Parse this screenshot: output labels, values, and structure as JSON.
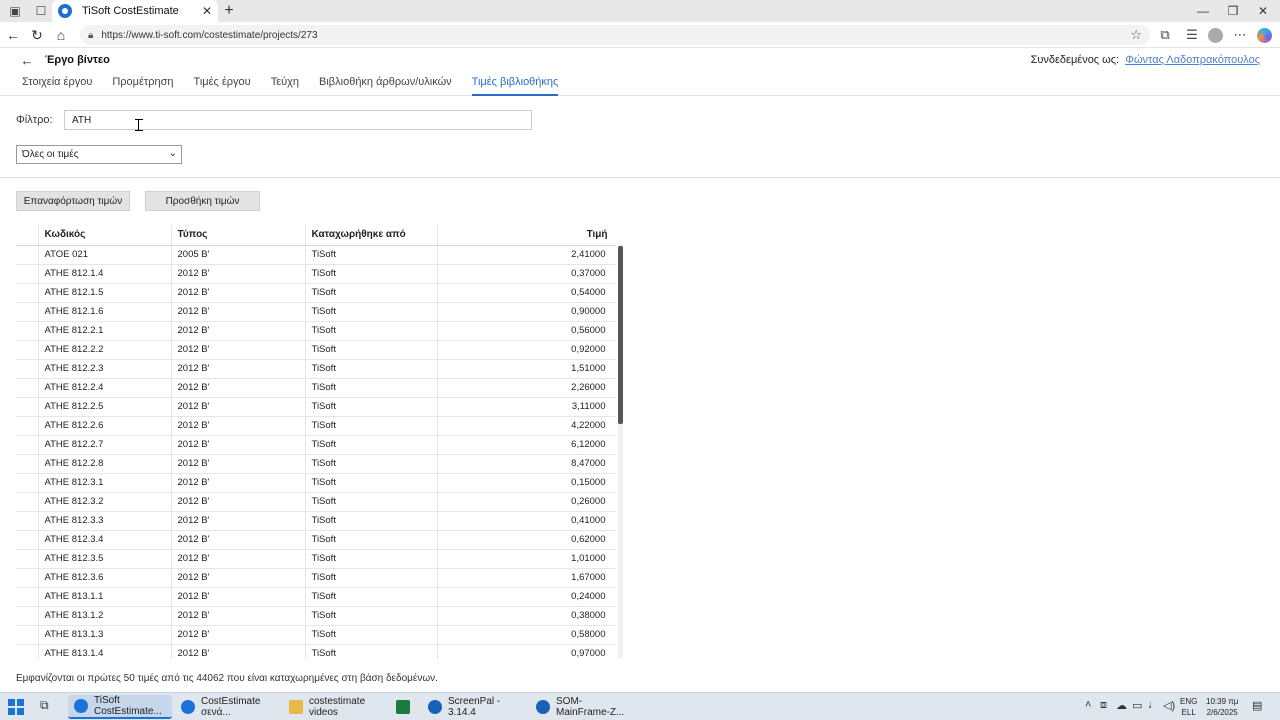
{
  "browser": {
    "tab_title": "TiSoft CostEstimate",
    "url": "https://www.ti-soft.com/costestimate/projects/273"
  },
  "app": {
    "project_title": "Έργο βίντεο",
    "login_label": "Συνδεδεμένος ως:",
    "user_name": "Φώντας Λαδοπρακόπουλος",
    "tabs": [
      {
        "label": "Στοιχεία έργου"
      },
      {
        "label": "Προμέτρηση"
      },
      {
        "label": "Τιμές έργου"
      },
      {
        "label": "Τεύχη"
      },
      {
        "label": "Βιβλιοθήκη άρθρων/υλικών"
      },
      {
        "label": "Τιμές βιβλιοθήκης"
      }
    ],
    "filter_label": "Φίλτρο:",
    "filter_value": "ATH",
    "select_value": "Όλες οι τιμές",
    "reset_button": "Επαναφόρτωση τιμών",
    "add_button": "Προσθήκη τιμών",
    "footer_note": "Εμφανίζονται οι πρώτες 50 τιμές από τις 44062 που είναι καταχωρημένες στη βάση δεδομένων."
  },
  "table": {
    "headers": [
      "Κωδικός",
      "Τύπος",
      "Καταχωρήθηκε από",
      "Τιμή"
    ],
    "rows": [
      [
        "ATOE 021",
        "2005 Β'",
        "TiSoft",
        "2,41000"
      ],
      [
        "ATHE 812.1.4",
        "2012 Β'",
        "TiSoft",
        "0,37000"
      ],
      [
        "ATHE 812.1.5",
        "2012 Β'",
        "TiSoft",
        "0,54000"
      ],
      [
        "ATHE 812.1.6",
        "2012 Β'",
        "TiSoft",
        "0,90000"
      ],
      [
        "ATHE 812.2.1",
        "2012 Β'",
        "TiSoft",
        "0,56000"
      ],
      [
        "ATHE 812.2.2",
        "2012 Β'",
        "TiSoft",
        "0,92000"
      ],
      [
        "ATHE 812.2.3",
        "2012 Β'",
        "TiSoft",
        "1,51000"
      ],
      [
        "ATHE 812.2.4",
        "2012 Β'",
        "TiSoft",
        "2,26000"
      ],
      [
        "ATHE 812.2.5",
        "2012 Β'",
        "TiSoft",
        "3,11000"
      ],
      [
        "ATHE 812.2.6",
        "2012 Β'",
        "TiSoft",
        "4,22000"
      ],
      [
        "ATHE 812.2.7",
        "2012 Β'",
        "TiSoft",
        "6,12000"
      ],
      [
        "ATHE 812.2.8",
        "2012 Β'",
        "TiSoft",
        "8,47000"
      ],
      [
        "ATHE 812.3.1",
        "2012 Β'",
        "TiSoft",
        "0,15000"
      ],
      [
        "ATHE 812.3.2",
        "2012 Β'",
        "TiSoft",
        "0,26000"
      ],
      [
        "ATHE 812.3.3",
        "2012 Β'",
        "TiSoft",
        "0,41000"
      ],
      [
        "ATHE 812.3.4",
        "2012 Β'",
        "TiSoft",
        "0,62000"
      ],
      [
        "ATHE 812.3.5",
        "2012 Β'",
        "TiSoft",
        "1,01000"
      ],
      [
        "ATHE 812.3.6",
        "2012 Β'",
        "TiSoft",
        "1,67000"
      ],
      [
        "ATHE 813.1.1",
        "2012 Β'",
        "TiSoft",
        "0,24000"
      ],
      [
        "ATHE 813.1.2",
        "2012 Β'",
        "TiSoft",
        "0,38000"
      ],
      [
        "ATHE 813.1.3",
        "2012 Β'",
        "TiSoft",
        "0,58000"
      ],
      [
        "ATHE 813.1.4",
        "2012 Β'",
        "TiSoft",
        "0,97000"
      ]
    ]
  },
  "taskbar": {
    "items": [
      {
        "label": "TiSoft CostEstimate...",
        "color": "#1a73d8"
      },
      {
        "label": "CostEstimate σενά...",
        "color": "#1a73d8"
      },
      {
        "label": "costestimate videos",
        "color": "#e8b84a"
      },
      {
        "label": "",
        "color": "#1d7a3d"
      },
      {
        "label": "ScreenPal - 3.14.4",
        "color": "#1a5fb8"
      },
      {
        "label": "SOM-MainFrame-Z...",
        "color": "#1a5fb8"
      }
    ],
    "lang_top": "ENG",
    "lang_bottom": "ELL",
    "time": "10:39 πμ",
    "date": "2/6/2025"
  }
}
